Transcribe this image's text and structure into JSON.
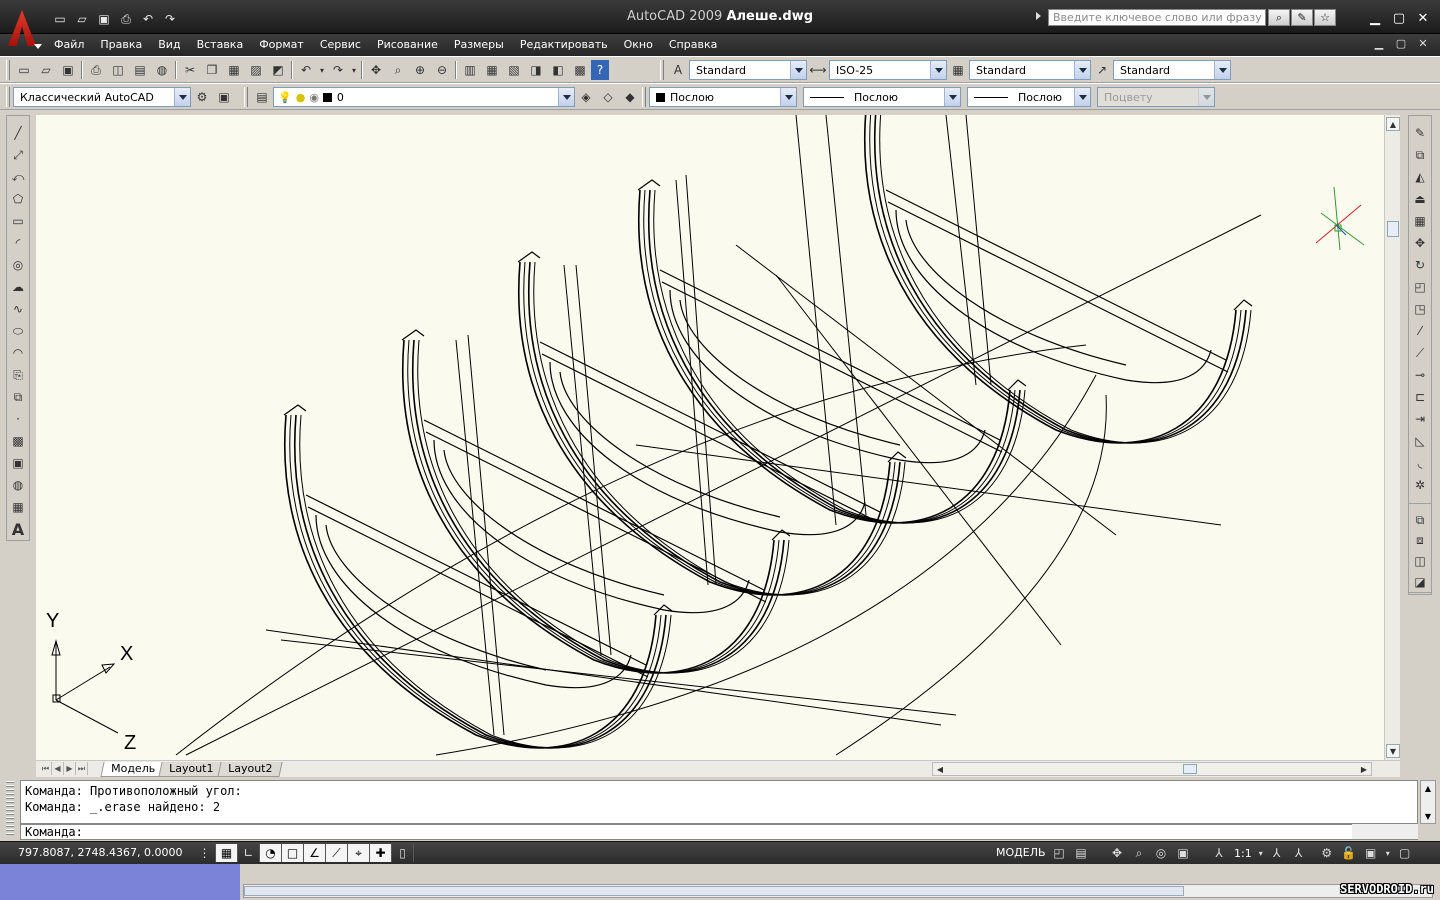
{
  "window": {
    "app_title": "AutoCAD 2009",
    "doc_title": "Алеше.dwg",
    "search_placeholder": "Введите ключевое слово или фразу",
    "controls": [
      "minimize-icon",
      "restore-icon",
      "close-icon"
    ]
  },
  "menu": [
    "Файл",
    "Правка",
    "Вид",
    "Вставка",
    "Формат",
    "Сервис",
    "Рисование",
    "Размеры",
    "Редактировать",
    "Окно",
    "Справка"
  ],
  "styles": {
    "text_style": "Standard",
    "dim_style": "ISO-25",
    "table_style": "Standard",
    "multileader_style": "Standard"
  },
  "layers": {
    "workspace": "Классический AutoCAD",
    "current_layer": "0",
    "color": "Послою",
    "linetype": "Послою",
    "lineweight": "Послою",
    "plot_style": "Поцвету"
  },
  "ucs": {
    "x_label": "X",
    "y_label": "Y",
    "z_label": "Z"
  },
  "tabs": [
    {
      "label": "Модель",
      "active": true
    },
    {
      "label": "Layout1",
      "active": false
    },
    {
      "label": "Layout2",
      "active": false
    }
  ],
  "command": {
    "history": [
      "Команда: Противоположный угол:",
      "Команда: _.erase найдено: 2"
    ],
    "prompt": "Команда:"
  },
  "status": {
    "coords": "797.8087, 2748.4367, 0.0000",
    "model_label": "МОДЕЛЬ",
    "annotation_scale": "1:1"
  },
  "watermark": "SERVODROID.ru",
  "colors": {
    "canvas_bg": "#fbfaef",
    "titlebar": "#2a2a2a",
    "accent_red": "#c8231a"
  }
}
